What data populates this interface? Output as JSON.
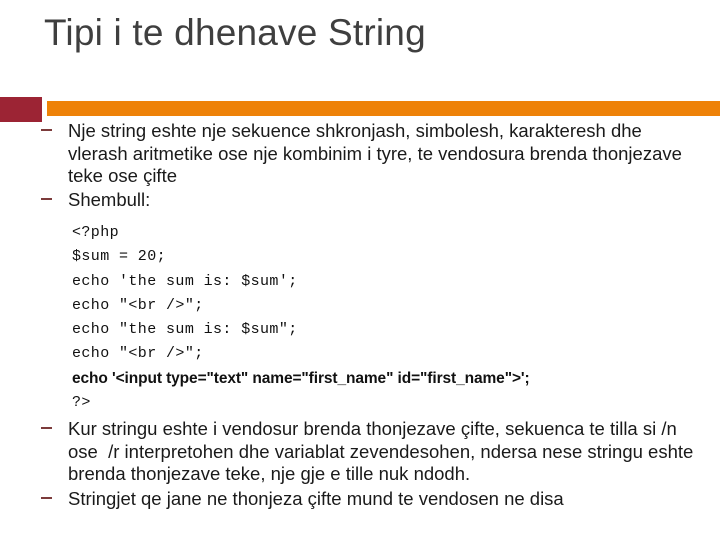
{
  "slide": {
    "title": "Tipi i te dhenave String",
    "colors": {
      "title_text": "#3f3f3f",
      "accent_block": "#9c2434",
      "accent_bar": "#ee8208",
      "bullet_dash": "#7c3b3b",
      "body_text": "#1a1a1a",
      "background": "#ffffff"
    },
    "bullets": [
      {
        "marker": "dash",
        "text": "Nje string eshte nje sekuence shkronjash, simbolesh, karakteresh dhe vlerash aritmetike ose nje kombinim i tyre, te vendosura brenda thonjezave teke ose çifte"
      },
      {
        "marker": "dash",
        "text": "Shembull:"
      },
      {
        "marker": "dash",
        "text": "Kur stringu eshte i vendosur brenda thonjezave çifte, sekuenca te tilla si /n  ose  /r interpretohen dhe variablat zevendesohen, ndersa nese stringu eshte brenda thonjezave teke, nje gje e tille nuk ndodh."
      },
      {
        "marker": "dash",
        "text": "Stringjet qe jane ne thonjeza çifte mund te vendosen ne disa"
      }
    ],
    "code_block": {
      "language": "php",
      "lines": [
        {
          "text": "<?php",
          "style": "mono"
        },
        {
          "text": "$sum = 20;",
          "style": "mono"
        },
        {
          "text": "echo 'the sum is: $sum';",
          "style": "mono"
        },
        {
          "text": "echo \"<br />\";",
          "style": "mono"
        },
        {
          "text": "echo \"the sum is: $sum\";",
          "style": "mono"
        },
        {
          "text": "echo \"<br />\";",
          "style": "mono"
        },
        {
          "text": "echo '<input type=\"text\" name=\"first_name\" id=\"first_name\">';",
          "style": "sans"
        },
        {
          "text": "?>",
          "style": "mono"
        }
      ]
    }
  }
}
